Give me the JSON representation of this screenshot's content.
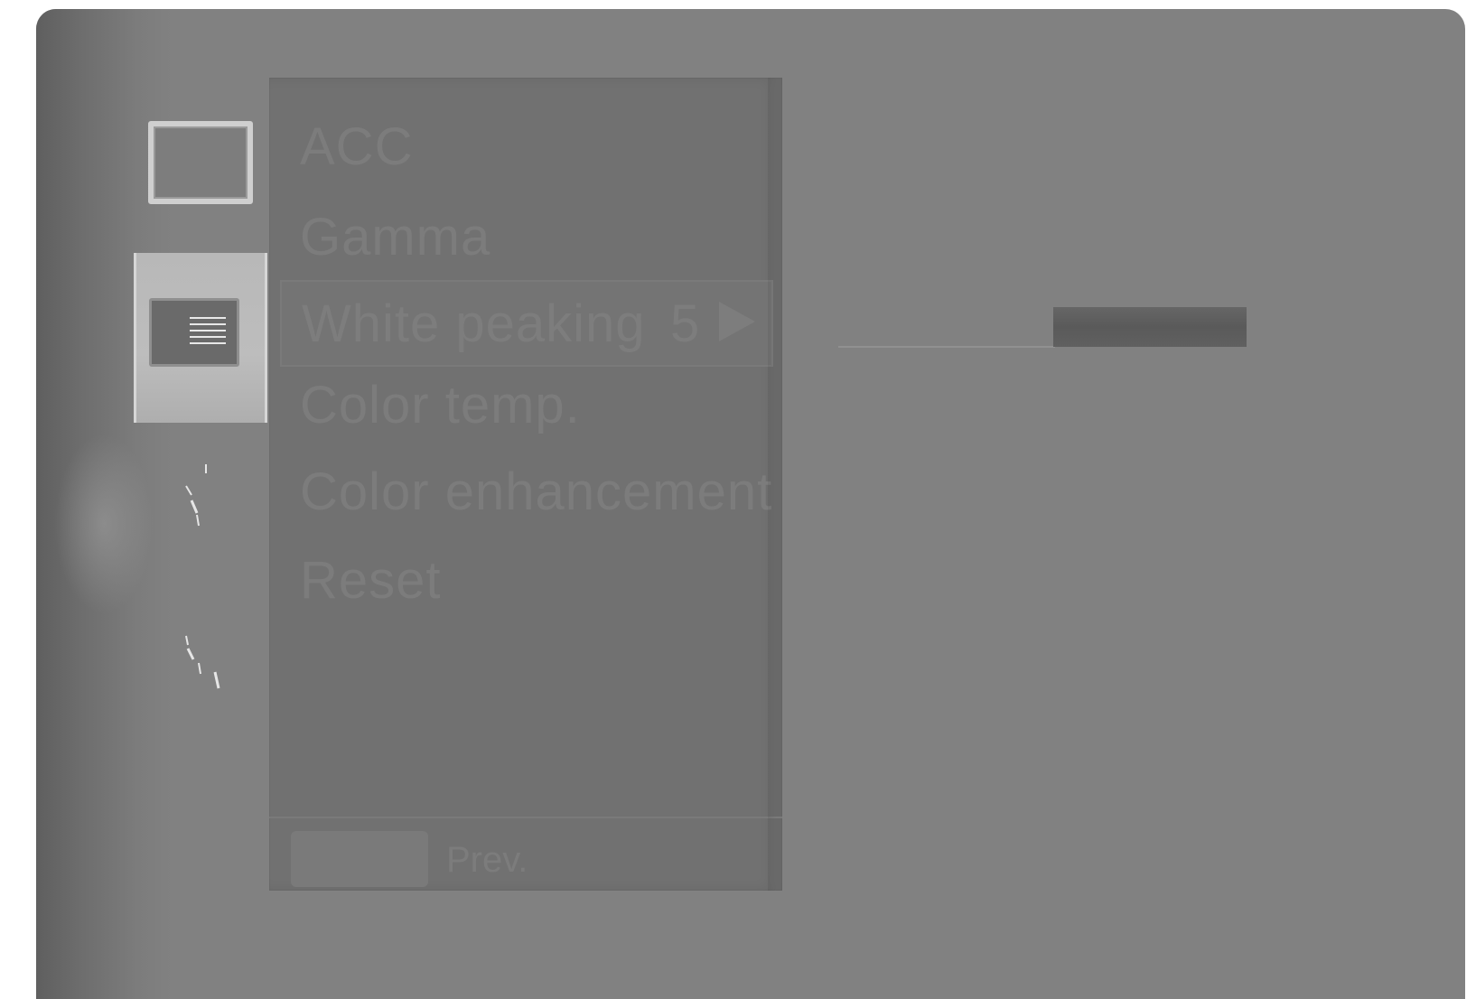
{
  "menu": {
    "items": [
      {
        "label": "ACC"
      },
      {
        "label": "Gamma"
      },
      {
        "label": "White peaking",
        "value": "5",
        "selected": true
      },
      {
        "label": "Color temp."
      },
      {
        "label": "Color enhancement"
      },
      {
        "label": "Reset"
      }
    ],
    "footer": {
      "prev_label": "Prev."
    }
  },
  "icons": {
    "picture": "picture-frame-icon",
    "selected": "menu-list-icon",
    "sparkle1": "sparkle-icon",
    "sparkle2": "sparkle-icon"
  },
  "slider": {
    "value": 5
  },
  "colors": {
    "screen": "#818181",
    "panel": "#717171",
    "selected_tab": "#bdbdbd",
    "slider_fill": "#5f5f5f"
  }
}
